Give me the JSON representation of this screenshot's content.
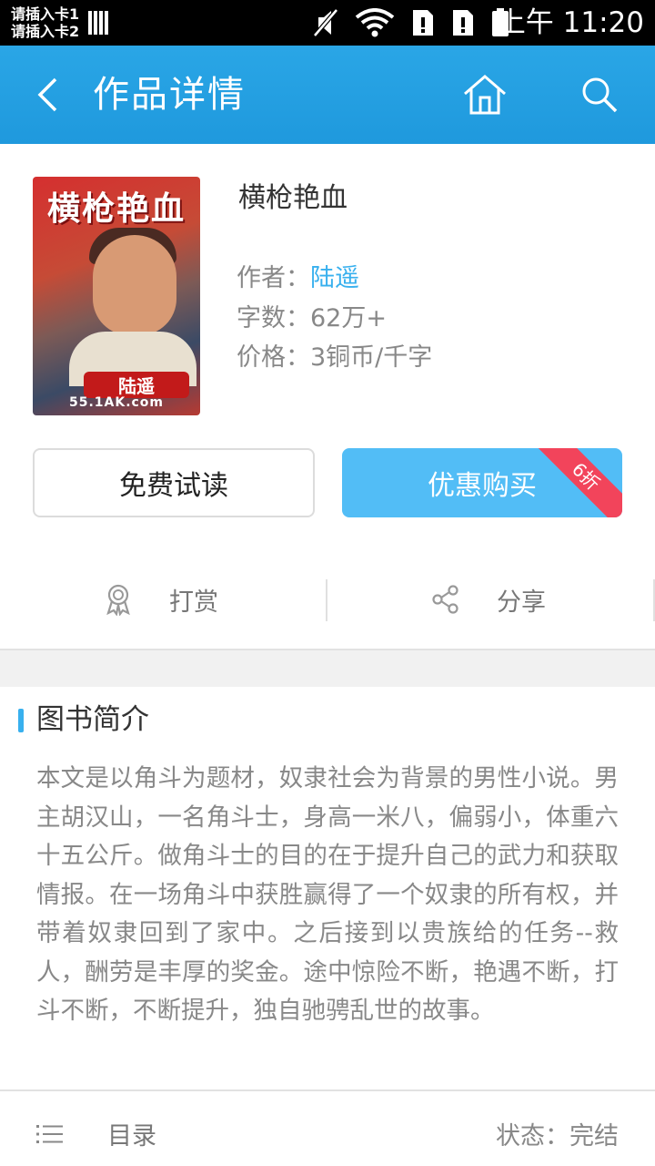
{
  "status_bar": {
    "sim1": "请插入卡1",
    "sim2": "请插入卡2",
    "time": "上午 11:20"
  },
  "toolbar": {
    "title": "作品详情",
    "icons": [
      "back-icon",
      "home-icon",
      "search-icon"
    ]
  },
  "book": {
    "cover_title": "横枪艳血",
    "cover_stamp": "陆遥",
    "cover_url": "55.1AK.com",
    "title": "横枪艳血",
    "author_label": "作者：",
    "author": "陆遥",
    "words_label": "字数：",
    "words": "62万+",
    "price_label": "价格：",
    "price": "3铜币/千字"
  },
  "buttons": {
    "free_read": "免费试读",
    "buy": "优惠购买",
    "discount": "6折"
  },
  "actions": {
    "reward": "打赏",
    "share": "分享"
  },
  "intro": {
    "title": "图书简介",
    "text": "本文是以角斗为题材，奴隶社会为背景的男性小说。男主胡汉山，一名角斗士，身高一米八，偏弱小，体重六十五公斤。做角斗士的目的在于提升自己的武力和获取情报。在一场角斗中获胜赢得了一个奴隶的所有权，并带着奴隶回到了家中。之后接到以贵族给的任务--救人，酬劳是丰厚的奖金。途中惊险不断，艳遇不断，打斗不断，不断提升，独自驰骋乱世的故事。"
  },
  "bottom": {
    "toc_label": "目录",
    "status": "状态：完结"
  },
  "colors": {
    "toolbar": "#1f99dd",
    "accent": "#38b0ee",
    "buy_button": "#52bdf6",
    "ribbon": "#f2445b"
  }
}
